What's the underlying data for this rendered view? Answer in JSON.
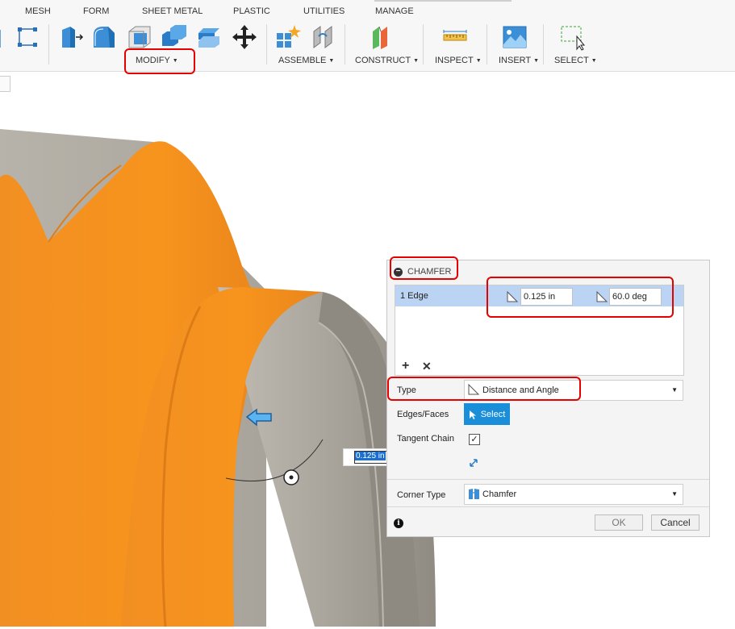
{
  "ribbon": {
    "tabs": [
      "MESH",
      "FORM",
      "SHEET METAL",
      "PLASTIC",
      "UTILITIES",
      "MANAGE"
    ],
    "groups": {
      "modify": "MODIFY",
      "assemble": "ASSEMBLE",
      "construct": "CONSTRUCT",
      "inspect": "INSPECT",
      "insert": "INSERT",
      "select": "SELECT"
    },
    "icons": [
      "extrude-icon",
      "fillet-icon",
      "shell-icon",
      "combine-icon",
      "scale-icon",
      "move-icon",
      "new-component-icon",
      "joint-icon",
      "offset-plane-icon",
      "measure-icon",
      "insert-image-icon",
      "window-select-icon"
    ]
  },
  "dialog": {
    "title": "CHAMFER",
    "selection": {
      "label": "1 Edge",
      "distance": "0.125 in",
      "angle": "60.0 deg"
    },
    "type_label": "Type",
    "type_value": "Distance and Angle",
    "edges_label": "Edges/Faces",
    "select_button": "Select",
    "tangent_label": "Tangent Chain",
    "tangent_checked": true,
    "corner_label": "Corner Type",
    "corner_value": "Chamfer",
    "ok": "OK",
    "cancel": "Cancel"
  },
  "canvas": {
    "dimension_value": "0.125 in"
  },
  "colors": {
    "highlight": "#e60000",
    "accent_blue": "#1a8ed8",
    "selection_row": "#bcd4f3",
    "model_orange": "#f28c1e",
    "model_grey": "#aaa69c"
  }
}
